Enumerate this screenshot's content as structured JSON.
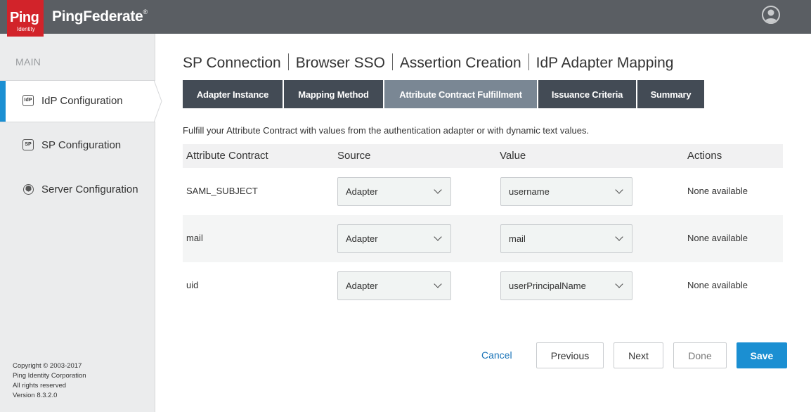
{
  "header": {
    "logo_text": "Ping",
    "logo_subtext": "Identity",
    "product_name": "PingFederate"
  },
  "sidebar": {
    "section_label": "MAIN",
    "items": [
      {
        "label": "IdP Configuration",
        "icon": "IdP",
        "icon_name": "idp-icon"
      },
      {
        "label": "SP Configuration",
        "icon": "SP",
        "icon_name": "sp-icon"
      },
      {
        "label": "Server Configuration",
        "icon_name": "server-icon"
      }
    ],
    "footer": {
      "copyright": "Copyright © 2003-2017",
      "company": "Ping Identity Corporation",
      "rights": "All rights reserved",
      "version": "Version 8.3.2.0"
    }
  },
  "breadcrumb": [
    "SP Connection",
    "Browser SSO",
    "Assertion Creation",
    "IdP Adapter Mapping"
  ],
  "tabs": [
    {
      "label": "Adapter Instance"
    },
    {
      "label": "Mapping Method"
    },
    {
      "label": "Attribute Contract Fulfillment"
    },
    {
      "label": "Issuance Criteria"
    },
    {
      "label": "Summary"
    }
  ],
  "instructions": "Fulfill your Attribute Contract with values from the authentication adapter or with dynamic text values.",
  "table": {
    "headers": [
      "Attribute Contract",
      "Source",
      "Value",
      "Actions"
    ],
    "rows": [
      {
        "attribute": "SAML_SUBJECT",
        "source": "Adapter",
        "value": "username",
        "actions": "None available"
      },
      {
        "attribute": "mail",
        "source": "Adapter",
        "value": "mail",
        "actions": "None available"
      },
      {
        "attribute": "uid",
        "source": "Adapter",
        "value": "userPrincipalName",
        "actions": "None available"
      }
    ]
  },
  "buttons": {
    "cancel": "Cancel",
    "previous": "Previous",
    "next": "Next",
    "done": "Done",
    "save": "Save"
  },
  "colors": {
    "brand_red": "#d2232a",
    "accent_blue": "#1b8fd2",
    "tab_dark": "#434b55",
    "tab_active": "#7a8794"
  }
}
